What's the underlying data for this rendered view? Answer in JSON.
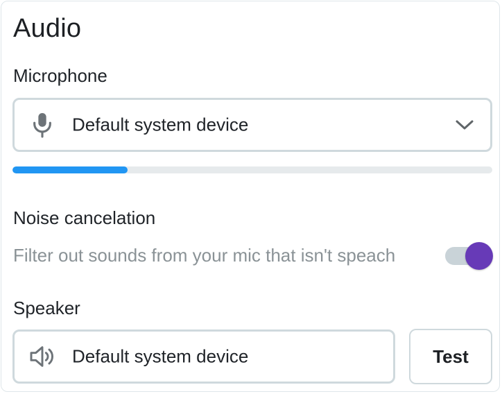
{
  "panel": {
    "title": "Audio"
  },
  "microphone": {
    "label": "Microphone",
    "icon": "microphone-icon",
    "selected": "Default system device",
    "level_fraction": 0.24
  },
  "noise_cancelation": {
    "label": "Noise cancelation",
    "description": "Filter out sounds from your mic that isn't speach",
    "enabled": true
  },
  "speaker": {
    "label": "Speaker",
    "icon": "speaker-icon",
    "selected": "Default system device",
    "test_label": "Test"
  },
  "colors": {
    "level_fill": "#2196f3",
    "toggle_knob": "#673ab7",
    "toggle_track": "#c9d3d8",
    "icon": "#6d7378"
  }
}
